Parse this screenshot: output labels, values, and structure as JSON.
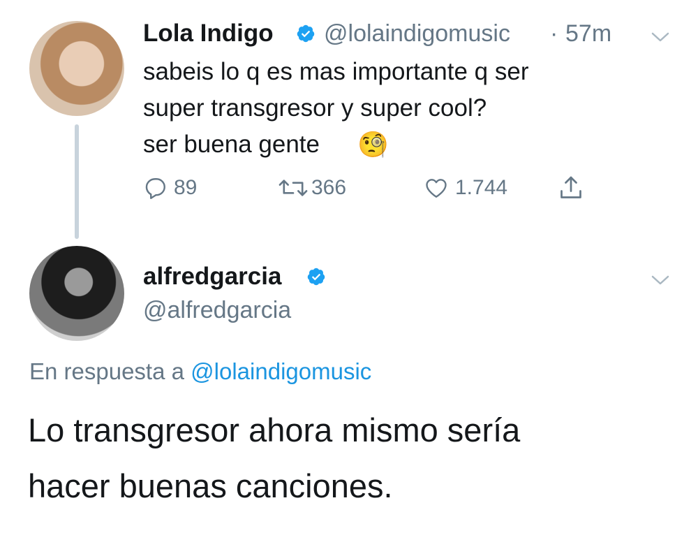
{
  "tweet": {
    "author_name": "Lola Indigo",
    "handle": "@lolaindigomusic",
    "separator": "·",
    "time": "57m",
    "lines": [
      "sabeis lo q es mas importante q ser",
      "super transgresor y super cool?",
      "ser buena gente"
    ],
    "emoji": "🧐",
    "actions": {
      "replies": "89",
      "retweets": "366",
      "likes": "1.744"
    }
  },
  "reply": {
    "author_name": "alfredgarcia",
    "handle": "@alfredgarcia",
    "context_prefix": "En respuesta a",
    "mention": "@lolaindigomusic",
    "lines": [
      "Lo transgresor ahora mismo sería",
      "hacer buenas canciones."
    ]
  },
  "colors": {
    "verified": "#1da1f2",
    "secondary_text": "#657786",
    "link": "#1b95e0",
    "thread_line": "#c8d3dc"
  },
  "icons": {
    "reply": "reply-icon",
    "retweet": "retweet-icon",
    "like": "heart-icon",
    "share": "share-icon",
    "verified": "verified-badge-icon",
    "menu": "chevron-down-icon"
  }
}
